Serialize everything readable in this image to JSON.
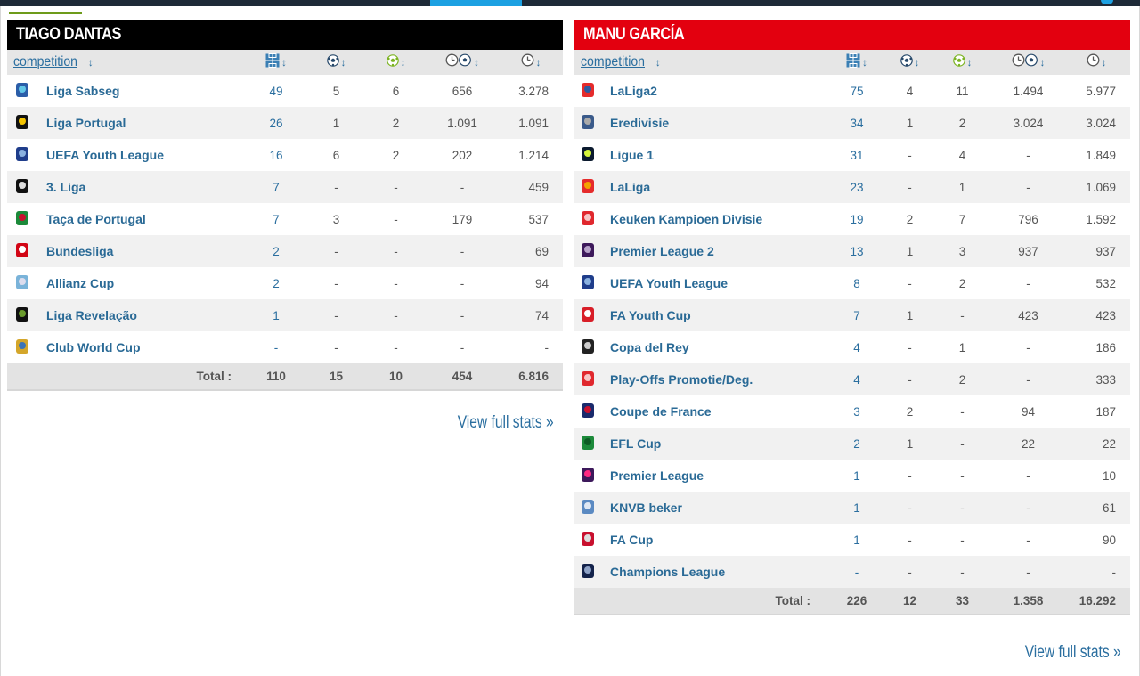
{
  "colors": {
    "left_header": "#000000",
    "right_header": "#e3000f",
    "link": "#2a6e9f",
    "accent": "#1da1e2"
  },
  "header_icons": [
    "lineup-icon",
    "ball-icon",
    "assist-ball-icon",
    "minutes-per-goal-icon",
    "minutes-icon"
  ],
  "left": {
    "title": "TIAGO DANTAS",
    "competition_label": "competition",
    "sort_glyph": "↕",
    "rows": [
      {
        "name": "Liga Sabseg",
        "icon": "liga-sabseg-icon",
        "apps": "49",
        "goals": "5",
        "assists": "6",
        "mpg": "656",
        "minutes": "3.278"
      },
      {
        "name": "Liga Portugal",
        "icon": "liga-portugal-icon",
        "apps": "26",
        "goals": "1",
        "assists": "2",
        "mpg": "1.091",
        "minutes": "1.091"
      },
      {
        "name": "UEFA Youth League",
        "icon": "uefa-youth-league-icon",
        "apps": "16",
        "goals": "6",
        "assists": "2",
        "mpg": "202",
        "minutes": "1.214"
      },
      {
        "name": "3. Liga",
        "icon": "3-liga-icon",
        "apps": "7",
        "goals": "-",
        "assists": "-",
        "mpg": "-",
        "minutes": "459"
      },
      {
        "name": "Taça de Portugal",
        "icon": "taca-de-portugal-icon",
        "apps": "7",
        "goals": "3",
        "assists": "-",
        "mpg": "179",
        "minutes": "537"
      },
      {
        "name": "Bundesliga",
        "icon": "bundesliga-icon",
        "apps": "2",
        "goals": "-",
        "assists": "-",
        "mpg": "-",
        "minutes": "69"
      },
      {
        "name": "Allianz Cup",
        "icon": "allianz-cup-icon",
        "apps": "2",
        "goals": "-",
        "assists": "-",
        "mpg": "-",
        "minutes": "94"
      },
      {
        "name": "Liga Revelação",
        "icon": "liga-revelacao-icon",
        "apps": "1",
        "goals": "-",
        "assists": "-",
        "mpg": "-",
        "minutes": "74"
      },
      {
        "name": "Club World Cup",
        "icon": "club-world-cup-icon",
        "apps": "-",
        "goals": "-",
        "assists": "-",
        "mpg": "-",
        "minutes": "-"
      }
    ],
    "total": {
      "label": "Total :",
      "apps": "110",
      "goals": "15",
      "assists": "10",
      "mpg": "454",
      "minutes": "6.816"
    },
    "view_full": "View full stats »"
  },
  "right": {
    "title": "MANU GARCÍA",
    "competition_label": "competition",
    "sort_glyph": "↕",
    "rows": [
      {
        "name": "LaLiga2",
        "icon": "laliga2-icon",
        "apps": "75",
        "goals": "4",
        "assists": "11",
        "mpg": "1.494",
        "minutes": "5.977"
      },
      {
        "name": "Eredivisie",
        "icon": "eredivisie-icon",
        "apps": "34",
        "goals": "1",
        "assists": "2",
        "mpg": "3.024",
        "minutes": "3.024"
      },
      {
        "name": "Ligue 1",
        "icon": "ligue-1-icon",
        "apps": "31",
        "goals": "-",
        "assists": "4",
        "mpg": "-",
        "minutes": "1.849"
      },
      {
        "name": "LaLiga",
        "icon": "laliga-icon",
        "apps": "23",
        "goals": "-",
        "assists": "1",
        "mpg": "-",
        "minutes": "1.069"
      },
      {
        "name": "Keuken Kampioen Divisie",
        "icon": "keuken-kampioen-divisie-icon",
        "apps": "19",
        "goals": "2",
        "assists": "7",
        "mpg": "796",
        "minutes": "1.592"
      },
      {
        "name": "Premier League 2",
        "icon": "premier-league-2-icon",
        "apps": "13",
        "goals": "1",
        "assists": "3",
        "mpg": "937",
        "minutes": "937"
      },
      {
        "name": "UEFA Youth League",
        "icon": "uefa-youth-league-icon",
        "apps": "8",
        "goals": "-",
        "assists": "2",
        "mpg": "-",
        "minutes": "532"
      },
      {
        "name": "FA Youth Cup",
        "icon": "fa-youth-cup-icon",
        "apps": "7",
        "goals": "1",
        "assists": "-",
        "mpg": "423",
        "minutes": "423"
      },
      {
        "name": "Copa del Rey",
        "icon": "copa-del-rey-icon",
        "apps": "4",
        "goals": "-",
        "assists": "1",
        "mpg": "-",
        "minutes": "186"
      },
      {
        "name": "Play-Offs Promotie/Deg.",
        "icon": "play-offs-icon",
        "apps": "4",
        "goals": "-",
        "assists": "2",
        "mpg": "-",
        "minutes": "333"
      },
      {
        "name": "Coupe de France",
        "icon": "coupe-de-france-icon",
        "apps": "3",
        "goals": "2",
        "assists": "-",
        "mpg": "94",
        "minutes": "187"
      },
      {
        "name": "EFL Cup",
        "icon": "efl-cup-icon",
        "apps": "2",
        "goals": "1",
        "assists": "-",
        "mpg": "22",
        "minutes": "22"
      },
      {
        "name": "Premier League",
        "icon": "premier-league-icon",
        "apps": "1",
        "goals": "-",
        "assists": "-",
        "mpg": "-",
        "minutes": "10"
      },
      {
        "name": "KNVB beker",
        "icon": "knvb-beker-icon",
        "apps": "1",
        "goals": "-",
        "assists": "-",
        "mpg": "-",
        "minutes": "61"
      },
      {
        "name": "FA Cup",
        "icon": "fa-cup-icon",
        "apps": "1",
        "goals": "-",
        "assists": "-",
        "mpg": "-",
        "minutes": "90"
      },
      {
        "name": "Champions League",
        "icon": "champions-league-icon",
        "apps": "-",
        "goals": "-",
        "assists": "-",
        "mpg": "-",
        "minutes": "-"
      }
    ],
    "total": {
      "label": "Total :",
      "apps": "226",
      "goals": "12",
      "assists": "33",
      "mpg": "1.358",
      "minutes": "16.292"
    },
    "view_full": "View full stats »"
  }
}
